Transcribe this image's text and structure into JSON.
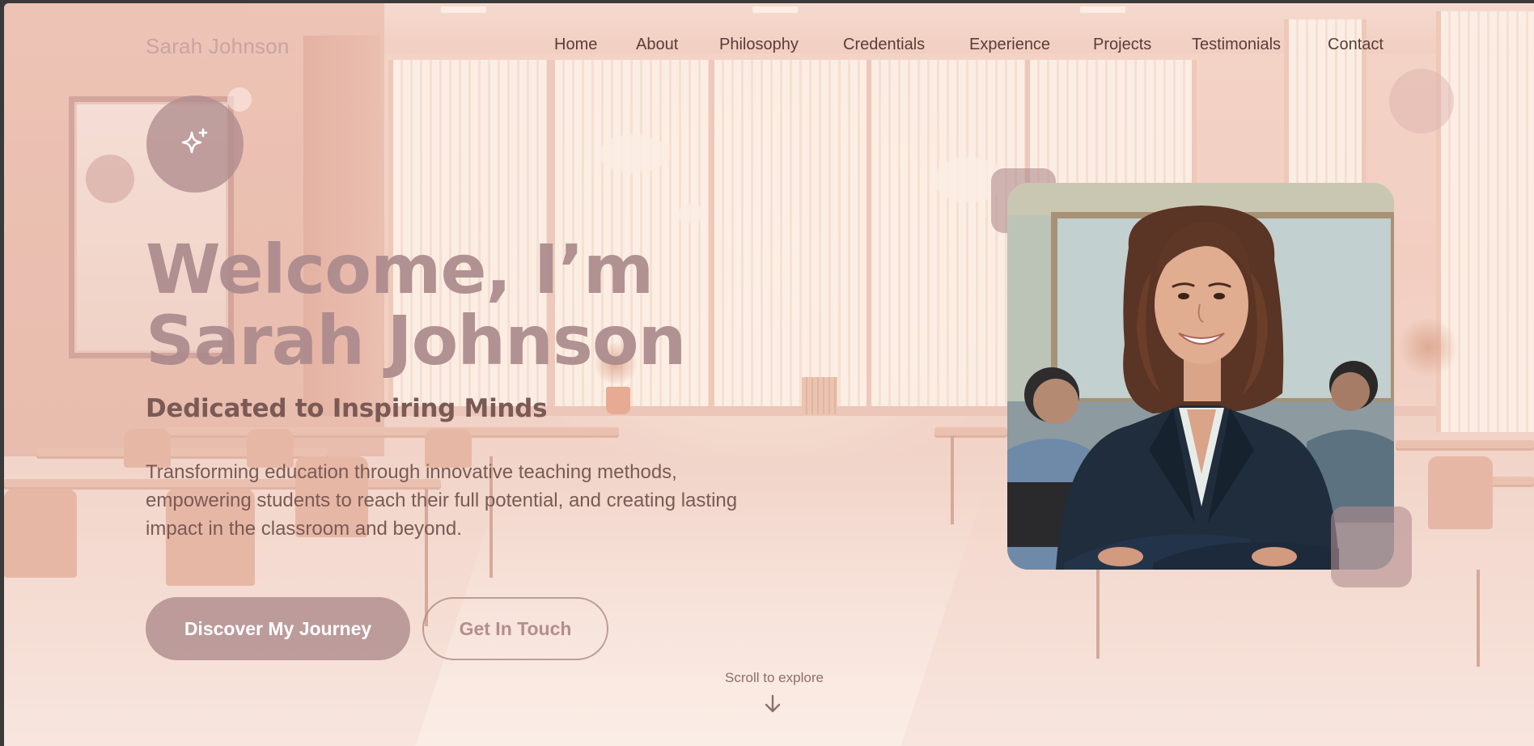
{
  "site": {
    "logo": "Sarah Johnson"
  },
  "nav": {
    "items": [
      {
        "label": "Home"
      },
      {
        "label": "About"
      },
      {
        "label": "Philosophy"
      },
      {
        "label": "Credentials"
      },
      {
        "label": "Experience"
      },
      {
        "label": "Projects"
      },
      {
        "label": "Testimonials"
      },
      {
        "label": "Contact"
      }
    ]
  },
  "hero": {
    "title_line1": "Welcome, I’m",
    "title_line2": "Sarah Johnson",
    "subtitle": "Dedicated to Inspiring Minds",
    "description": "Transforming education through innovative teaching methods, empowering students to reach their full potential, and creating lasting impact in the classroom and beyond.",
    "primary_button": "Discover My Journey",
    "secondary_button": "Get In Touch",
    "scroll_hint": "Scroll to explore",
    "badge_icon": "sparkles-icon"
  },
  "photo": {
    "subject": "portrait-photo"
  },
  "colors": {
    "accent": "#b08c8e",
    "text_dark": "#5a3d38",
    "background": "#f4d3c6"
  }
}
